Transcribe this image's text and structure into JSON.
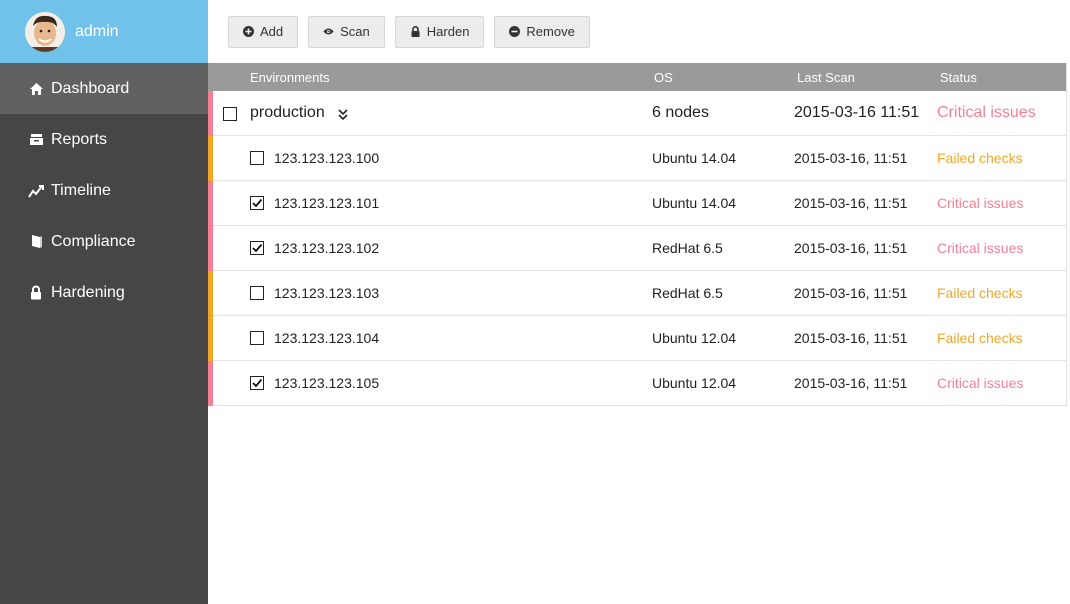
{
  "user": {
    "name": "admin"
  },
  "nav": [
    {
      "label": "Dashboard",
      "icon": "home-icon",
      "active": true
    },
    {
      "label": "Reports",
      "icon": "inbox-icon"
    },
    {
      "label": "Timeline",
      "icon": "line-chart-icon"
    },
    {
      "label": "Compliance",
      "icon": "book-icon"
    },
    {
      "label": "Hardening",
      "icon": "lock-icon"
    }
  ],
  "toolbar": {
    "add": "Add",
    "scan": "Scan",
    "harden": "Harden",
    "remove": "Remove"
  },
  "table": {
    "headers": {
      "environments": "Environments",
      "os": "OS",
      "last_scan": "Last Scan",
      "status": "Status"
    },
    "environment": {
      "name": "production",
      "os": "6 nodes",
      "last_scan": "2015-03-16 11:51",
      "status": "Critical issues",
      "checked": false
    },
    "nodes": [
      {
        "ip": "123.123.123.100",
        "os": "Ubuntu 14.04",
        "last_scan": "2015-03-16, 11:51",
        "status": "Failed checks",
        "checked": false
      },
      {
        "ip": "123.123.123.101",
        "os": "Ubuntu 14.04",
        "last_scan": "2015-03-16, 11:51",
        "status": "Critical issues",
        "checked": true
      },
      {
        "ip": "123.123.123.102",
        "os": "RedHat 6.5",
        "last_scan": "2015-03-16, 11:51",
        "status": "Critical issues",
        "checked": true
      },
      {
        "ip": "123.123.123.103",
        "os": "RedHat 6.5",
        "last_scan": "2015-03-16, 11:51",
        "status": "Failed checks",
        "checked": false
      },
      {
        "ip": "123.123.123.104",
        "os": "Ubuntu 12.04",
        "last_scan": "2015-03-16, 11:51",
        "status": "Failed checks",
        "checked": false
      },
      {
        "ip": "123.123.123.105",
        "os": "Ubuntu 12.04",
        "last_scan": "2015-03-16, 11:51",
        "status": "Critical issues",
        "checked": true
      }
    ]
  },
  "colors": {
    "critical": "#f77f95",
    "failed": "#f0a824",
    "sidebar": "#464646",
    "header_user": "#70c2ea"
  }
}
